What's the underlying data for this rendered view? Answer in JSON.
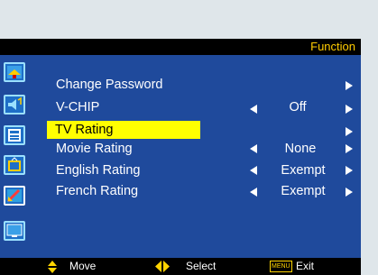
{
  "header": {
    "title": "Function"
  },
  "menu": [
    {
      "label": "Change Password",
      "value": "",
      "has_left": false,
      "has_right": true
    },
    {
      "label": "V-CHIP",
      "value": "Off",
      "has_left": true,
      "has_right": true
    },
    {
      "label": "TV  Rating",
      "value": "",
      "has_left": false,
      "has_right": true,
      "selected": true
    },
    {
      "label": "Movie Rating",
      "value": "None",
      "has_left": true,
      "has_right": true
    },
    {
      "label": "English Rating",
      "value": "Exempt",
      "has_left": true,
      "has_right": true
    },
    {
      "label": "French Rating",
      "value": "Exempt",
      "has_left": true,
      "has_right": true
    }
  ],
  "sidebar_icons": [
    "picture-icon",
    "audio-icon",
    "setup-icon",
    "tv-icon",
    "function-icon",
    "screen-icon"
  ],
  "footer": {
    "move_label": "Move",
    "select_label": "Select",
    "menu_key": "MENU",
    "exit_label": "Exit"
  },
  "colors": {
    "panel": "#1f4a9c",
    "highlight": "#ffff00",
    "title_text": "#ffcc00",
    "footer_bg": "#000000",
    "page_bg": "#dfe6ea"
  }
}
